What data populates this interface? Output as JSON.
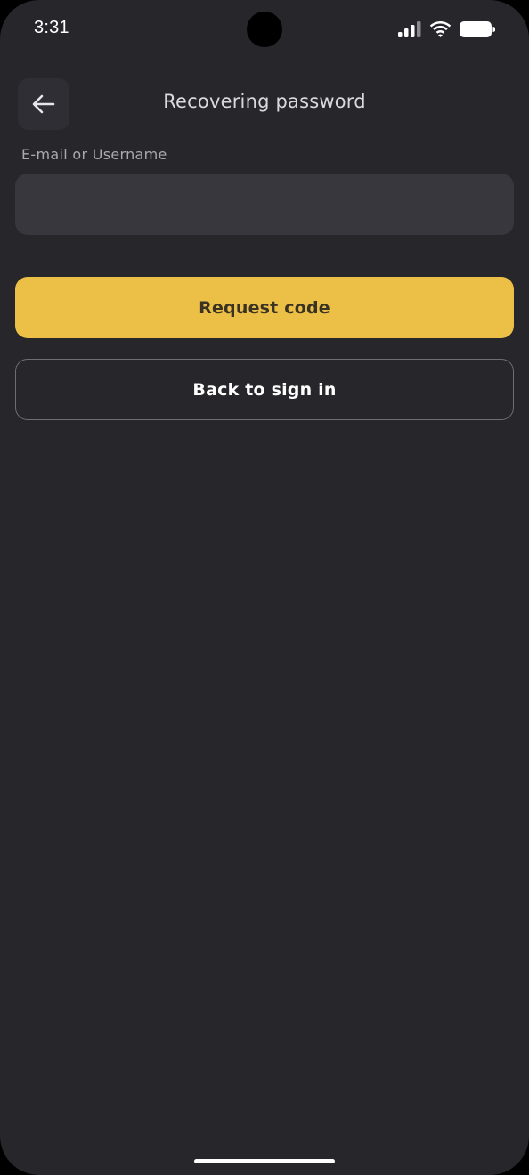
{
  "status_bar": {
    "time": "3:31",
    "icons": [
      "signal-icon",
      "wifi-icon",
      "battery-icon"
    ]
  },
  "header": {
    "back_icon": "arrow-left-icon",
    "title": "Recovering password"
  },
  "form": {
    "email_label": "E-mail or Username",
    "email_value": "",
    "email_placeholder": ""
  },
  "actions": {
    "request_code_label": "Request code",
    "back_to_sign_in_label": "Back to sign in"
  },
  "colors": {
    "background": "#27262b",
    "accent": "#ecbf47",
    "input_background": "#38373d"
  }
}
